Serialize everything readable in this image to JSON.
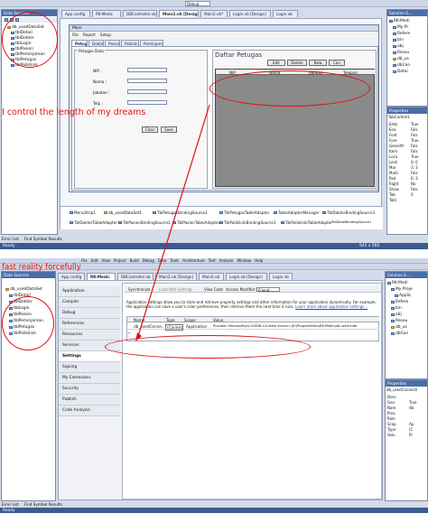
{
  "screen1": {
    "menu_title": "...",
    "tabs": [
      "App.config",
      "RK-Medic",
      "DBController.vb",
      "Main2.vb [Design]*",
      "Main2.vb*",
      "Login.vb [Design]",
      "Login.vb"
    ],
    "debug_label": "Debug",
    "data_sources_title": "Data Sources",
    "data_sources_items": [
      "db_usedDataSet",
      "tblDetail",
      "tblDokter",
      "tblLogin",
      "tblPasien",
      "tblPeminjaman",
      "tblPetugas",
      "tblPoliklinik"
    ],
    "solution_title": "Solution E...",
    "solution_items": [
      "RK-Medi",
      "My Pr",
      "Refere",
      "bin",
      "obj",
      "Resou",
      "db_us",
      "dbCon",
      "Detai"
    ],
    "form": {
      "title": "Main",
      "menu": [
        "File",
        "Report",
        "Setup"
      ],
      "tabs": [
        "Petugas",
        "Dokter",
        "Pasien",
        "Poliklinik",
        "Peminjaman"
      ],
      "group_label": "Petugas Data",
      "fields": [
        "NIP :",
        "Nama :",
        "Jabatan :",
        "Telp :"
      ],
      "clear_button": "Clear",
      "save_button": "Save",
      "daftar_title": "Daftar Petugas",
      "toolbar": [
        "Edit",
        "Delete",
        "New",
        "Can"
      ],
      "columns": [
        "NIP",
        "Nama",
        "Jabatan",
        "Telepon"
      ]
    },
    "properties_title": "Properties",
    "properties_sub": "TabControl1",
    "properties_items": [
      "Emb",
      "Ena",
      "Font",
      "Fore",
      "GenerM",
      "Item",
      "Loca",
      "Lock",
      "Mar",
      "Multi",
      "Pad",
      "Right",
      "Show",
      "Tab",
      "Tabl"
    ],
    "properties_values": [
      "True",
      "Fals",
      "Fals",
      "True",
      "Fals",
      "Fals",
      "True",
      "0; 0",
      "3; 3",
      "Fals",
      "6; 3",
      "No",
      "Fals",
      "0"
    ],
    "tray": [
      "MenuStrip1",
      "db_usedDataSet1",
      "TblPetugasBindingSource1",
      "TblPetugasTableAdapter",
      "TableAdapterManager",
      "TblDokterBindingSource1",
      "TblDokterTableAdapter",
      "TblPasienBindingSource1",
      "TblPasienTableAdapter",
      "TblPoliklinikBindingSource1",
      "TblPoliklinikTableAdapter",
      "TblDetailBindingSource1",
      "TblDetailTableAdapter"
    ],
    "bottom_tabs": [
      "Error List",
      "Find Symbol Results"
    ],
    "status": "Ready",
    "size_readout": "945 x 560",
    "annotation": "I control the length of my dreams"
  },
  "screen2": {
    "tabs": [
      "App.config",
      "RK-Medic",
      "DBController.vb",
      "Main2.vb [Design]",
      "Main2.vb",
      "Login.vb [Design]",
      "Login.vb"
    ],
    "menu": [
      "File",
      "Edit",
      "View",
      "Project",
      "Build",
      "Debug",
      "Data",
      "Tools",
      "Architecture",
      "Test",
      "Analyze",
      "Window",
      "Help"
    ],
    "data_sources_title": "Data Sources",
    "data_sources_items": [
      "db_usedDataSet",
      "tblDetail",
      "tblDokter",
      "tblLogin",
      "tblPasien",
      "tblPeminjaman",
      "tblPetugas",
      "tblPoliklinik"
    ],
    "vtabs": [
      "Application",
      "Compile",
      "Debug",
      "References",
      "Resources",
      "Services",
      "Settings",
      "Signing",
      "My Extensions",
      "Security",
      "Publish",
      "Code Analysis"
    ],
    "active_vtab": "Settings",
    "toolbar": {
      "sync": "Synchronize",
      "load": "Load Web Settings",
      "view_code": "View Code",
      "access_label": "Access Modifier:",
      "access_value": "Friend"
    },
    "description": "Application settings allow you to store and retrieve property settings and other information for your application dynamically. For example, the application can save a user's color preferences, then retrieve them the next time it runs.",
    "description_link": "Learn more about application settings...",
    "columns": [
      "Name",
      "Type",
      "Scope",
      "Value"
    ],
    "row": {
      "name": "db_usedConne...",
      "type": "(Connectio...",
      "scope": "Application",
      "value": "Provider=Microsoft.Jet.OLEDB.4.0;Data Source=|D:\\ProgramData\\RK-Medic\\db-used.mdb"
    },
    "solution_title": "Solution E...",
    "solution_items": [
      "RK-Medi",
      "My Proje",
      "Applic",
      "Refere",
      "bin",
      "obj",
      "Resou",
      "db_us",
      "dbCon"
    ],
    "properties_title": "Properties",
    "properties_sub": "db_usedConnecti",
    "properties_items": [
      "Desc",
      "Gen",
      "Nam",
      "Prov",
      "Role",
      "Scop",
      "Type",
      "Valu"
    ],
    "properties_values": [
      "",
      "True",
      "db",
      "",
      "",
      "Ap",
      "(C",
      "Pr"
    ],
    "bottom_tabs": [
      "Error List",
      "Find Symbol Results"
    ],
    "status": "Ready",
    "annotation": "fast reality forcefully"
  },
  "colors": {
    "accent": "#4b6ea9",
    "annotation": "#e81010",
    "grid": "#8a8a8a"
  }
}
